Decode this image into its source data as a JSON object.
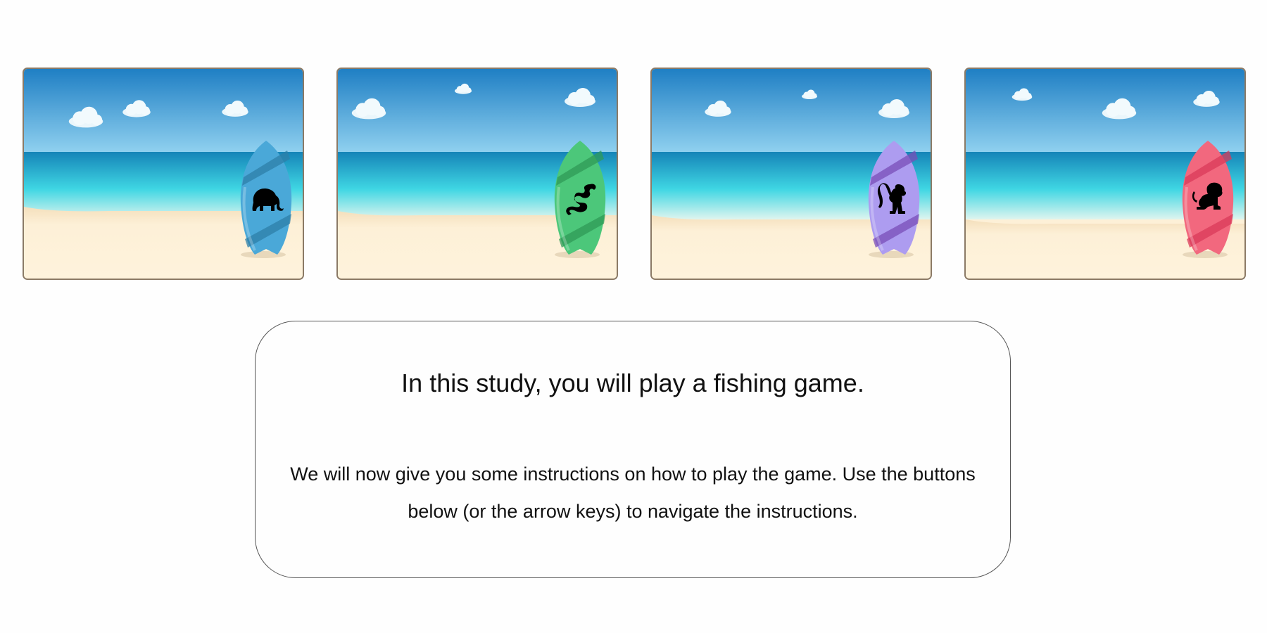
{
  "beaches": [
    {
      "board_color": "#4aa8d8",
      "board_stripe": "#2e7fa8",
      "animal": "elephant-icon",
      "clouds": 3
    },
    {
      "board_color": "#4cc77a",
      "board_stripe": "#2f9a57",
      "animal": "snake-icon",
      "clouds": 3
    },
    {
      "board_color": "#ad9cf0",
      "board_stripe": "#7a4db8",
      "animal": "monkey-icon",
      "clouds": 3
    },
    {
      "board_color": "#f2687e",
      "board_stripe": "#d93a5a",
      "animal": "lion-icon",
      "clouds": 3
    }
  ],
  "colors": {
    "sky_top": "#1f7fc4",
    "sky_bottom": "#8fd0ef",
    "sea_deep": "#1584b8",
    "sea_shallow": "#3fd6e3",
    "sand": "#fdf0d7",
    "card_border": "#8b7a66"
  },
  "instructions": {
    "title": "In this study, you will play a fishing game.",
    "body": "We will now give you some instructions on how to play the game. Use the buttons below (or the arrow keys) to navigate the instructions."
  }
}
